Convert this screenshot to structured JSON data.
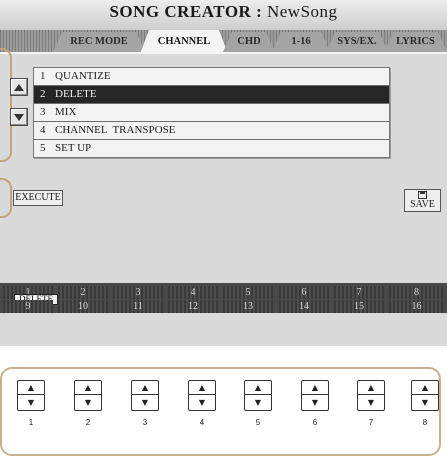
{
  "title": {
    "prefix": "SONG CREATOR : ",
    "song": "NewSong"
  },
  "tabs": [
    {
      "label": "REC MODE",
      "active": false
    },
    {
      "label": "CHANNEL",
      "active": true
    },
    {
      "label": "CHD",
      "active": false
    },
    {
      "label": "1-16",
      "active": false
    },
    {
      "label": "SYS/EX.",
      "active": false
    },
    {
      "label": "LYRICS",
      "active": false
    }
  ],
  "menu": {
    "items": [
      {
        "num": "1",
        "label": "QUANTIZE"
      },
      {
        "num": "2",
        "label": "DELETE"
      },
      {
        "num": "3",
        "label": "MIX"
      },
      {
        "num": "4",
        "label": "CHANNEL  TRANSPOSE"
      },
      {
        "num": "5",
        "label": "SET UP"
      }
    ],
    "selected_index": 1,
    "up_icon": "up-arrow-icon",
    "down_icon": "down-arrow-icon"
  },
  "actions": {
    "execute_label": "EXECUTE",
    "save_label": "SAVE",
    "save_icon": "floppy-disk-icon"
  },
  "channels": {
    "top_row": [
      "1",
      "2",
      "3",
      "4",
      "5",
      "6",
      "7",
      "8"
    ],
    "bottom_row": [
      "9",
      "10",
      "11",
      "12",
      "13",
      "14",
      "15",
      "16"
    ],
    "ch1_badge": "DELETE"
  },
  "hardware_buttons": {
    "labels": [
      "1",
      "2",
      "3",
      "4",
      "5",
      "6",
      "7",
      "8"
    ],
    "up_symbol": "▲",
    "down_symbol": "▼"
  },
  "colors": {
    "screen_bg": "#dadada",
    "selected_row": "#262626",
    "channel_bar": "#494949",
    "frame_accent": "#c7b28c"
  }
}
